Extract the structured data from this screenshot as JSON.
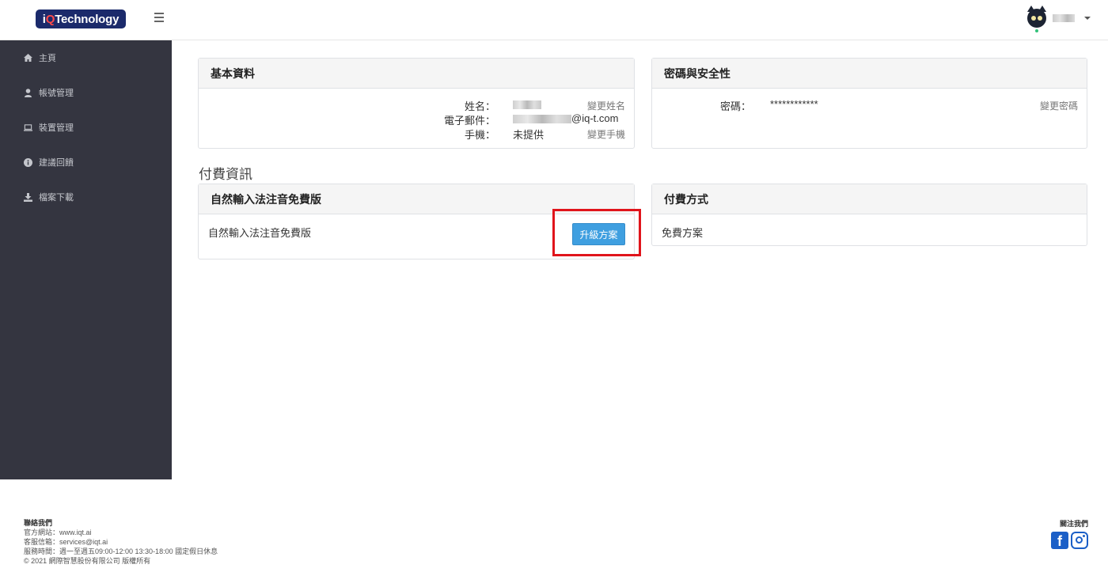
{
  "header": {
    "logo_prefix": "i",
    "logo_q": "Q",
    "logo_suffix": " Technology",
    "menu_icon": "hamburger-icon",
    "user_avatar": "cat-avatar"
  },
  "sidebar": {
    "items": [
      {
        "label": "主頁",
        "icon": "home-icon"
      },
      {
        "label": "帳號管理",
        "icon": "user-icon"
      },
      {
        "label": "裝置管理",
        "icon": "laptop-icon"
      },
      {
        "label": "建議回饋",
        "icon": "info-icon"
      },
      {
        "label": "檔案下載",
        "icon": "download-icon"
      }
    ]
  },
  "basic_info": {
    "title": "基本資料",
    "name_label": "姓名：",
    "email_label": "電子郵件：",
    "email_suffix": "@iq-t.com",
    "phone_label": "手機：",
    "phone_value": "未提供",
    "change_name": "變更姓名",
    "change_phone": "變更手機"
  },
  "security": {
    "title": "密碼與安全性",
    "password_label": "密碼：",
    "password_value": "************",
    "change_password": "變更密碼"
  },
  "payment_section_title": "付費資訊",
  "plan": {
    "title": "自然輸入法注音免費版",
    "description": "自然輸入法注音免費版",
    "upgrade_button": "升級方案"
  },
  "payment_method": {
    "title": "付費方式",
    "value": "免費方案"
  },
  "footer": {
    "contact_title": "聯絡我們",
    "website": "官方網站：www.iqt.ai",
    "service_email": "客服信箱：services@iqt.ai",
    "service_hours": "服務時間：週一至週五09:00-12:00 13:30-18:00 國定假日休息",
    "copyright": "© 2021 網際智慧股份有限公司 版權所有",
    "follow_title": "關注我們",
    "facebook_icon": "facebook-icon",
    "instagram_icon": "instagram-icon"
  },
  "colors": {
    "sidebar_bg": "#343540",
    "primary_button": "#3f9fe0",
    "highlight_border": "#e0141b",
    "logo_bg": "#1b2a6b"
  }
}
